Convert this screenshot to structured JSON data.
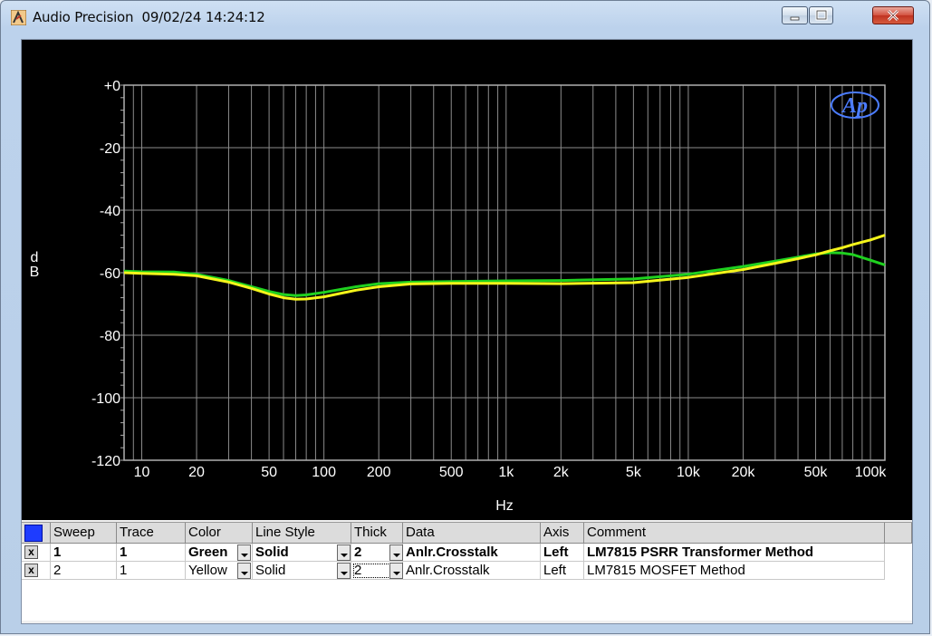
{
  "window": {
    "app_name": "Audio Precision",
    "timestamp": "09/02/24 14:24:12",
    "minimize_label": "",
    "restore_label": "",
    "close_label": ""
  },
  "chart_data": {
    "type": "line",
    "title": "",
    "xlabel": "Hz",
    "ylabel": "d\nB",
    "xscale": "log",
    "xlim": [
      8,
      120000
    ],
    "ylim": [
      -120,
      0
    ],
    "grid": true,
    "logo": "Ap",
    "x_ticks": [
      {
        "value": 10,
        "label": "10"
      },
      {
        "value": 20,
        "label": "20"
      },
      {
        "value": 50,
        "label": "50"
      },
      {
        "value": 100,
        "label": "100"
      },
      {
        "value": 200,
        "label": "200"
      },
      {
        "value": 500,
        "label": "500"
      },
      {
        "value": 1000,
        "label": "1k"
      },
      {
        "value": 2000,
        "label": "2k"
      },
      {
        "value": 5000,
        "label": "5k"
      },
      {
        "value": 10000,
        "label": "10k"
      },
      {
        "value": 20000,
        "label": "20k"
      },
      {
        "value": 50000,
        "label": "50k"
      },
      {
        "value": 100000,
        "label": "100k"
      }
    ],
    "y_ticks": [
      {
        "value": 0,
        "label": "+0"
      },
      {
        "value": -20,
        "label": "-20"
      },
      {
        "value": -40,
        "label": "-40"
      },
      {
        "value": -60,
        "label": "-60"
      },
      {
        "value": -80,
        "label": "-80"
      },
      {
        "value": -100,
        "label": "-100"
      },
      {
        "value": -120,
        "label": "-120"
      }
    ],
    "series": [
      {
        "name": "LM7815 PSRR Transformer Method",
        "color": "#1fd11f",
        "x": [
          8,
          10,
          15,
          20,
          30,
          40,
          50,
          60,
          70,
          80,
          100,
          150,
          200,
          300,
          500,
          1000,
          2000,
          5000,
          10000,
          20000,
          30000,
          40000,
          50000,
          60000,
          70000,
          80000,
          100000,
          120000
        ],
        "y": [
          -59.5,
          -59.7,
          -59.8,
          -60.5,
          -62.5,
          -64.5,
          -66,
          -67,
          -67.3,
          -67.1,
          -66.3,
          -64.5,
          -63.5,
          -63,
          -62.8,
          -62.6,
          -62.5,
          -62,
          -60.5,
          -58,
          -56.3,
          -55,
          -54,
          -53.6,
          -53.7,
          -54.2,
          -56,
          -57.5
        ]
      },
      {
        "name": "LM7815 MOSFET Method",
        "color": "#f5f51a",
        "x": [
          8,
          10,
          15,
          20,
          30,
          40,
          50,
          60,
          70,
          80,
          100,
          150,
          200,
          300,
          500,
          1000,
          2000,
          5000,
          10000,
          20000,
          30000,
          40000,
          50000,
          60000,
          70000,
          80000,
          100000,
          120000
        ],
        "y": [
          -60,
          -60.2,
          -60.5,
          -61,
          -63,
          -65,
          -66.8,
          -68,
          -68.5,
          -68.4,
          -67.7,
          -65.6,
          -64.5,
          -63.6,
          -63.4,
          -63.4,
          -63.5,
          -63.2,
          -61.5,
          -59,
          -57,
          -55.5,
          -54.3,
          -53,
          -52,
          -51,
          -49.5,
          -48
        ]
      }
    ]
  },
  "table": {
    "headers": [
      "Sweep",
      "Trace",
      "Color",
      "Line Style",
      "Thick",
      "Data",
      "Axis",
      "Comment"
    ],
    "rows": [
      {
        "enabled": "x",
        "sweep": "1",
        "trace": "1",
        "color": "Green",
        "line_style": "Solid",
        "thick": "2",
        "data": "Anlr.Crosstalk",
        "axis": "Left",
        "comment": "LM7815 PSRR Transformer Method"
      },
      {
        "enabled": "x",
        "sweep": "2",
        "trace": "1",
        "color": "Yellow",
        "line_style": "Solid",
        "thick": "2",
        "data": "Anlr.Crosstalk",
        "axis": "Left",
        "comment": "LM7815 MOSFET Method"
      }
    ]
  }
}
